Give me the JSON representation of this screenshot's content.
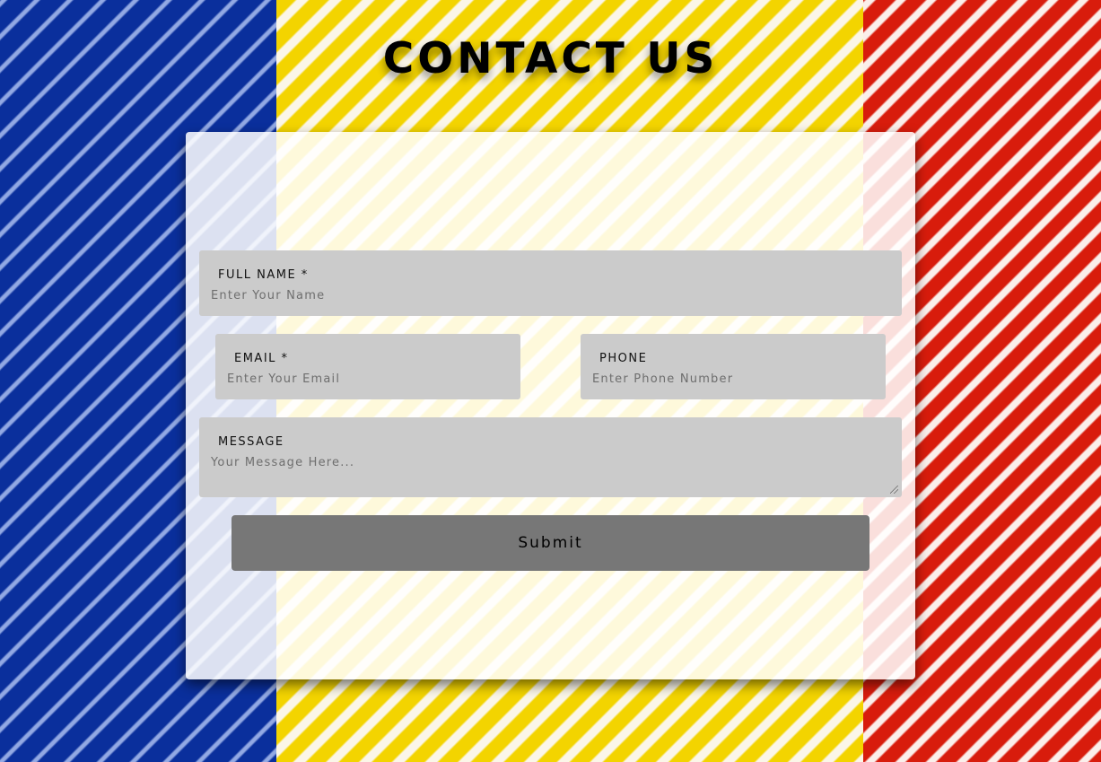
{
  "page": {
    "title": "CONTACT US",
    "colors": {
      "flag_blue": "#0a2f9c",
      "flag_yellow": "#f3d400",
      "flag_red": "#d81c0c",
      "field_bg": "#cbcbcb",
      "button_bg": "#777777"
    }
  },
  "form": {
    "full_name": {
      "label": "FULL NAME *",
      "placeholder": "Enter Your Name",
      "value": ""
    },
    "email": {
      "label": "EMAIL *",
      "placeholder": "Enter Your Email",
      "value": ""
    },
    "phone": {
      "label": "PHONE",
      "placeholder": "Enter Phone Number",
      "value": ""
    },
    "message": {
      "label": "MESSAGE",
      "placeholder": "Your Message Here...",
      "value": ""
    },
    "submit_label": "Submit"
  }
}
